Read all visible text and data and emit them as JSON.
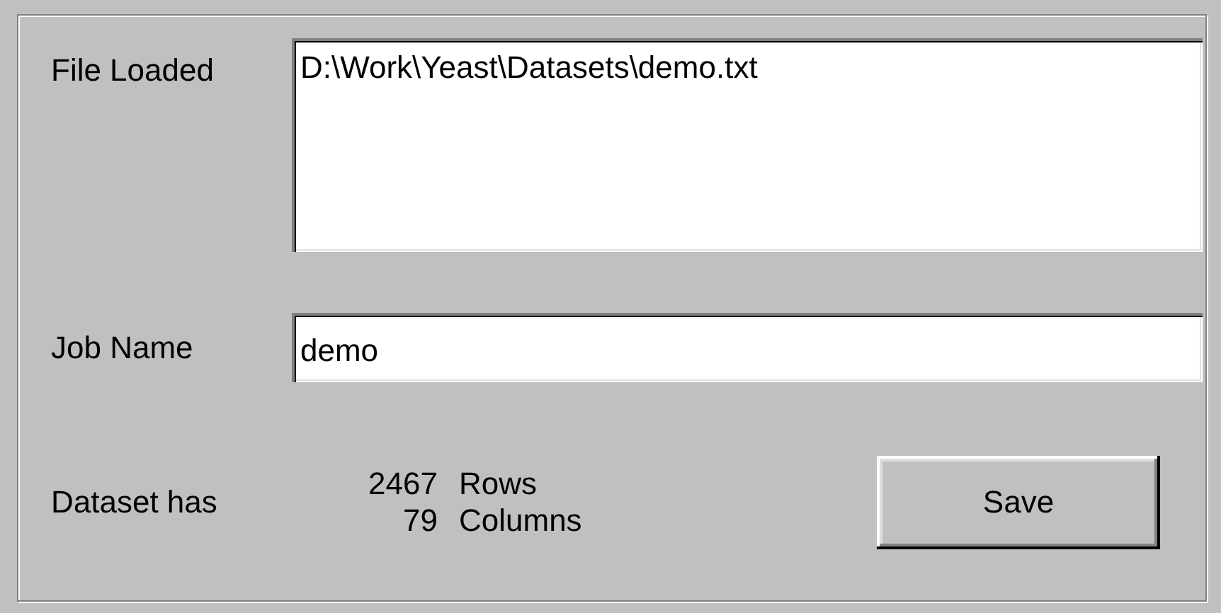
{
  "file_loaded": {
    "label": "File Loaded",
    "value": "D:\\Work\\Yeast\\Datasets\\demo.txt"
  },
  "job_name": {
    "label": "Job Name",
    "value": "demo"
  },
  "dataset": {
    "label": "Dataset has",
    "counts": [
      {
        "number": "2467",
        "unit": "Rows"
      },
      {
        "number": "79",
        "unit": "Columns"
      }
    ]
  },
  "buttons": [
    {
      "label": "Save"
    }
  ]
}
